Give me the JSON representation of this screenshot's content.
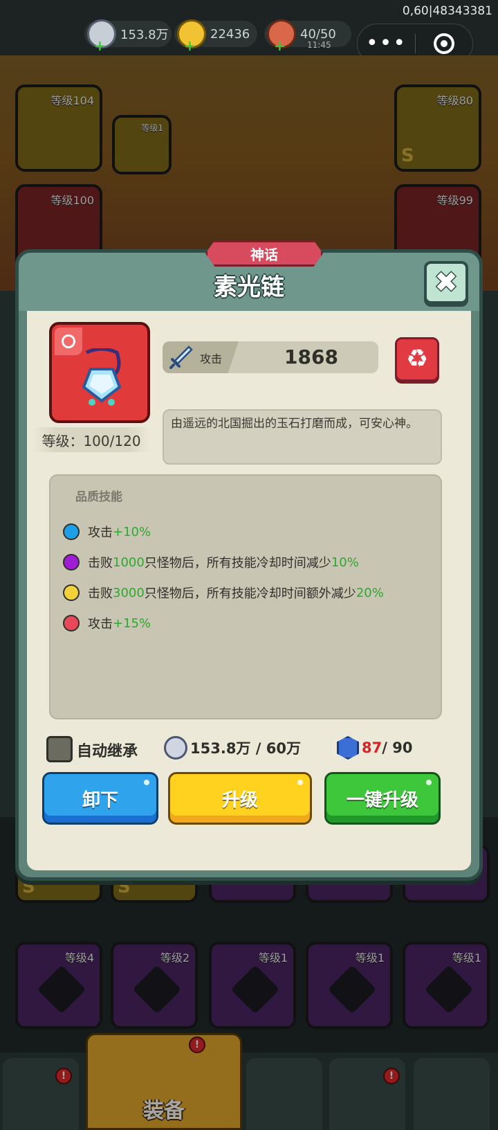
{
  "status": {
    "fps_text": "0,60|48343381",
    "silver": "153.8万",
    "gold": "22436",
    "stamina": "40/50",
    "stamina_timer": "11:45"
  },
  "capsule": {
    "more_glyph": "•••",
    "more_icon": "more-icon",
    "close_icon": "target-icon"
  },
  "background": {
    "slots": [
      {
        "level": "等级104"
      },
      {
        "level": "等级1"
      },
      {
        "level": "等级80"
      },
      {
        "level": "等级100"
      },
      {
        "level": "等级99"
      },
      {
        "level": "等级4"
      },
      {
        "level": "等级2"
      },
      {
        "level": "等级1"
      },
      {
        "level": "等级1"
      },
      {
        "level": "等级1"
      }
    ]
  },
  "modal": {
    "rarity": "神话",
    "title": "素光链",
    "close_glyph": "✖",
    "item_level": "等级：100/120",
    "attack_label": "攻击",
    "attack_value": "1868",
    "recycle_glyph": "♻",
    "description": "由遥远的北国掘出的玉石打磨而成，可安心神。",
    "skills_title": "品质技能",
    "skills": [
      {
        "dot_color": "#1e9fe8",
        "pre": "攻击",
        "hl": "+10%",
        "mid": "",
        "hl2": "",
        "post": ""
      },
      {
        "dot_color": "#a01cd6",
        "pre": "击败",
        "hl": "1000",
        "mid": "只怪物后，所有技能冷却时间减少",
        "hl2": "10%",
        "post": ""
      },
      {
        "dot_color": "#f2d13a",
        "pre": "击败",
        "hl": "3000",
        "mid": "只怪物后，所有技能冷却时间额外减少",
        "hl2": "20%",
        "post": ""
      },
      {
        "dot_color": "#e8485a",
        "pre": "攻击",
        "hl": "+15%",
        "mid": "",
        "hl2": "",
        "post": ""
      }
    ],
    "auto_inherit_label": "自动继承",
    "coin_cost": "153.8万 / 60万",
    "gem_have": "87",
    "gem_need": " / 90",
    "buttons": {
      "unequip": "卸下",
      "upgrade": "升级",
      "one_click": "一键升级"
    }
  },
  "nav": {
    "active_label": "装备"
  },
  "colors": {
    "rarity": "#d84a5e",
    "item_card": "#e03a3a",
    "highlight": "#2ea82e",
    "gem_have": "#d62323"
  }
}
